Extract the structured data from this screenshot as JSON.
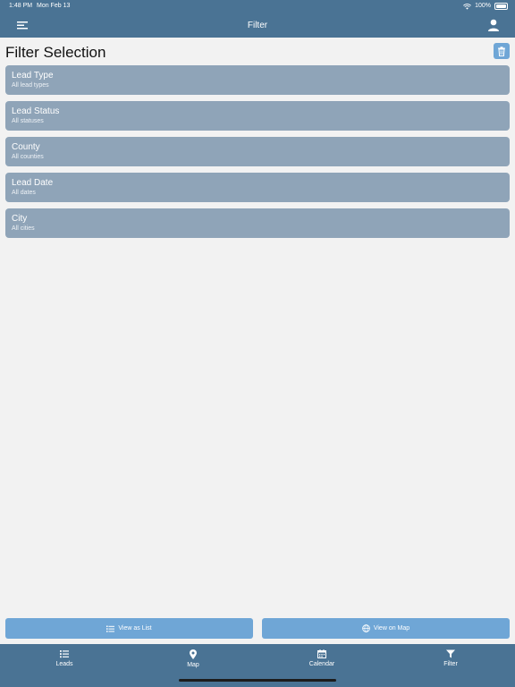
{
  "status_bar": {
    "time": "1:48 PM",
    "date": "Mon Feb 13",
    "battery": "100%"
  },
  "nav": {
    "title": "Filter"
  },
  "page": {
    "title": "Filter Selection"
  },
  "filters": [
    {
      "label": "Lead Type",
      "value": "All lead types"
    },
    {
      "label": "Lead Status",
      "value": "All statuses"
    },
    {
      "label": "County",
      "value": "All counties"
    },
    {
      "label": "Lead Date",
      "value": "All dates"
    },
    {
      "label": "City",
      "value": "All cities"
    }
  ],
  "actions": {
    "list_label": "View as List",
    "map_label": "View on Map"
  },
  "tabs": [
    {
      "label": "Leads",
      "icon": "list-icon"
    },
    {
      "label": "Map",
      "icon": "map-pin-icon"
    },
    {
      "label": "Calendar",
      "icon": "calendar-icon"
    },
    {
      "label": "Filter",
      "icon": "filter-icon"
    }
  ],
  "colors": {
    "header": "#4a7394",
    "filter_row": "#8fa4b8",
    "button": "#6fa6d6",
    "background": "#f2f2f2"
  }
}
